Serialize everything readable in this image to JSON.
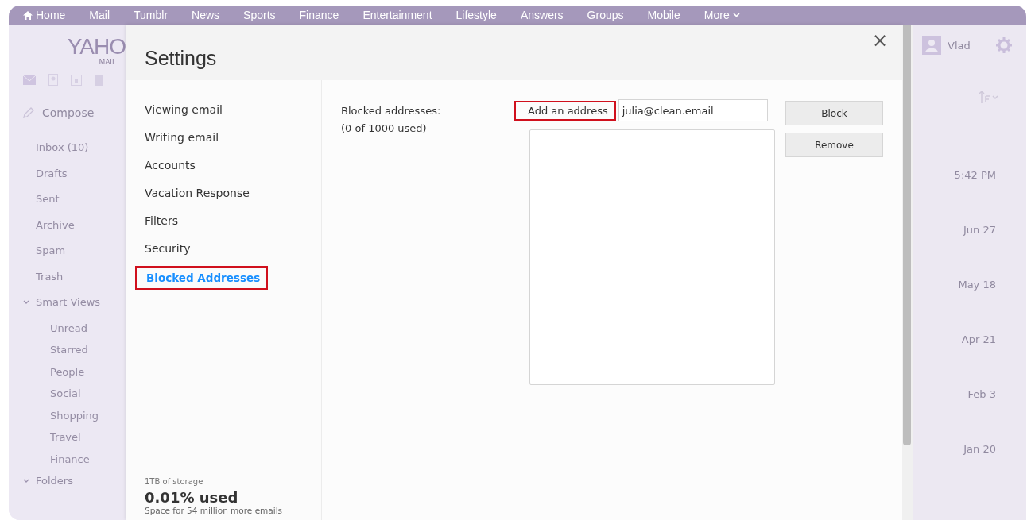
{
  "top_nav": [
    {
      "label": "Home",
      "icon": true
    },
    {
      "label": "Mail"
    },
    {
      "label": "Tumblr"
    },
    {
      "label": "News"
    },
    {
      "label": "Sports"
    },
    {
      "label": "Finance"
    },
    {
      "label": "Entertainment"
    },
    {
      "label": "Lifestyle"
    },
    {
      "label": "Answers"
    },
    {
      "label": "Groups"
    },
    {
      "label": "Mobile"
    },
    {
      "label": "More",
      "caret": true
    }
  ],
  "mail_sidebar": {
    "logo": "YAHO",
    "logo_sub": "MAIL",
    "compose": "Compose",
    "folders": [
      {
        "label": "Inbox (10)"
      },
      {
        "label": "Drafts"
      },
      {
        "label": "Sent"
      },
      {
        "label": "Archive"
      },
      {
        "label": "Spam"
      },
      {
        "label": "Trash"
      },
      {
        "label": "Smart Views",
        "expanded": true,
        "children": [
          {
            "label": "Unread"
          },
          {
            "label": "Starred"
          },
          {
            "label": "People"
          },
          {
            "label": "Social"
          },
          {
            "label": "Shopping"
          },
          {
            "label": "Travel"
          },
          {
            "label": "Finance"
          }
        ]
      },
      {
        "label": "Folders",
        "expanded": true
      }
    ]
  },
  "mail_right": {
    "user": "Vlad",
    "dates": [
      "5:42 PM",
      "Jun 27",
      "May 18",
      "Apr 21",
      "Feb 3",
      "Jan 20"
    ]
  },
  "settings": {
    "title": "Settings",
    "close": "×",
    "nav": [
      {
        "label": "Viewing email",
        "selected": false,
        "highlighted": false
      },
      {
        "label": "Writing email",
        "selected": false,
        "highlighted": false
      },
      {
        "label": "Accounts",
        "selected": false,
        "highlighted": false
      },
      {
        "label": "Vacation Response",
        "selected": false,
        "highlighted": false
      },
      {
        "label": "Filters",
        "selected": false,
        "highlighted": false
      },
      {
        "label": "Security",
        "selected": false,
        "highlighted": false
      },
      {
        "label": "Blocked Addresses",
        "selected": true,
        "highlighted": true
      }
    ],
    "storage": {
      "caption": "1TB of storage",
      "used": "0.01% used",
      "note": "Space for 54 million more emails"
    },
    "blocked": {
      "label": "Blocked addresses:",
      "count": "(0 of 1000 used)",
      "add_label": "Add an address",
      "add_highlighted": true,
      "input_value": "julia@clean.email",
      "buttons": [
        "Block",
        "Remove"
      ]
    }
  }
}
